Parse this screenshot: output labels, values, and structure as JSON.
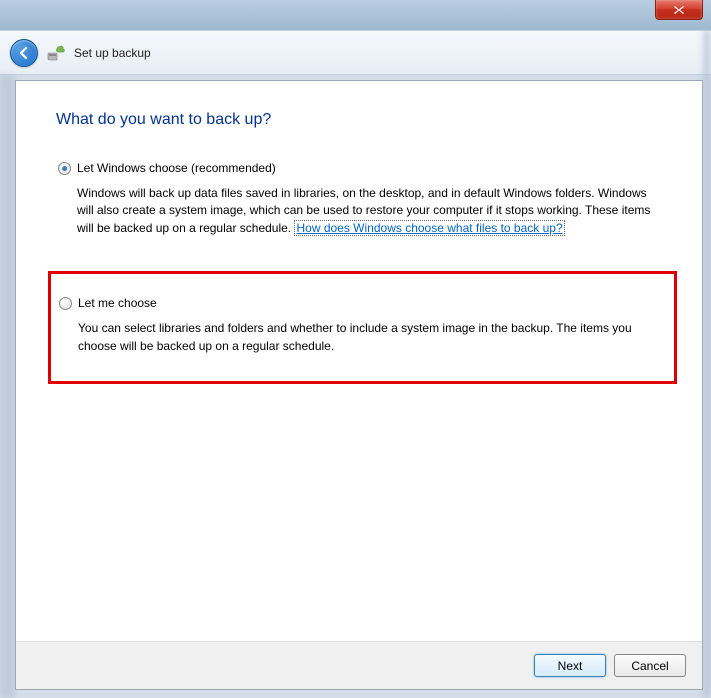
{
  "header": {
    "title": "Set up backup"
  },
  "page": {
    "heading": "What do you want to back up?"
  },
  "options": {
    "recommended": {
      "label": "Let Windows choose (recommended)",
      "description": "Windows will back up data files saved in libraries, on the desktop, and in default Windows folders. Windows will also create a system image, which can be used to restore your computer if it stops working. These items will be backed up on a regular schedule. ",
      "link": "How does Windows choose what files to back up?"
    },
    "custom": {
      "label": "Let me choose",
      "description": "You can select libraries and folders and whether to include a system image in the backup. The items you choose will be backed up on a regular schedule."
    }
  },
  "buttons": {
    "next": "Next",
    "cancel": "Cancel"
  }
}
